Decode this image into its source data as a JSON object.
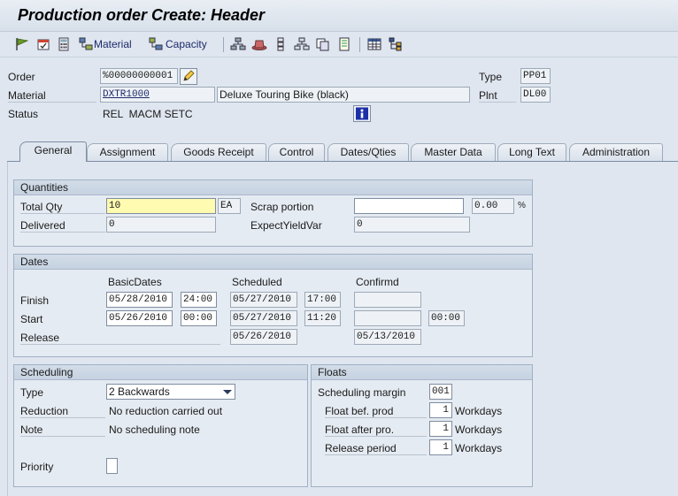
{
  "window": {
    "title": "Production order Create: Header"
  },
  "toolbar": {
    "material_label": "Material",
    "capacity_label": "Capacity"
  },
  "header": {
    "order_label": "Order",
    "order_value": "%00000000001",
    "type_label": "Type",
    "type_value": "PP01",
    "material_label": "Material",
    "material_value": "DXTR1000",
    "material_desc": "Deluxe Touring Bike (black)",
    "plnt_label": "Plnt",
    "plnt_value": "DL00",
    "status_label": "Status",
    "status_value": "REL  MACM SETC"
  },
  "tabs": [
    "General",
    "Assignment",
    "Goods Receipt",
    "Control",
    "Dates/Qties",
    "Master Data",
    "Long Text",
    "Administration"
  ],
  "quantities": {
    "title": "Quantities",
    "total_qty_label": "Total Qty",
    "total_qty_value": "10",
    "unit": "EA",
    "scrap_label": "Scrap portion",
    "scrap_value": "",
    "scrap_pct": "0.00",
    "pct_sign": "%",
    "delivered_label": "Delivered",
    "delivered_value": "0",
    "expect_label": "ExpectYieldVar",
    "expect_value": "0"
  },
  "dates": {
    "title": "Dates",
    "col_basic": "BasicDates",
    "col_scheduled": "Scheduled",
    "col_confirmed": "Confirmd",
    "finish_label": "Finish",
    "finish_basic_date": "05/28/2010",
    "finish_basic_time": "24:00",
    "finish_sched_date": "05/27/2010",
    "finish_sched_time": "17:00",
    "start_label": "Start",
    "start_basic_date": "05/26/2010",
    "start_basic_time": "00:00",
    "start_sched_date": "05/27/2010",
    "start_sched_time": "11:20",
    "start_conf_time": "00:00",
    "release_label": "Release",
    "release_sched_date": "05/26/2010",
    "release_conf_date": "05/13/2010"
  },
  "scheduling": {
    "title": "Scheduling",
    "type_label": "Type",
    "type_value": "2 Backwards",
    "reduction_label": "Reduction",
    "reduction_value": "No reduction carried out",
    "note_label": "Note",
    "note_value": "No scheduling note",
    "priority_label": "Priority",
    "priority_value": ""
  },
  "floats": {
    "title": "Floats",
    "margin_label": "Scheduling margin",
    "margin_value": "001",
    "before_label": "Float bef. prod",
    "before_value": "1",
    "after_label": "Float after pro.",
    "after_value": "1",
    "release_label": "Release period",
    "release_value": "1",
    "unit": "Workdays"
  },
  "colors": {
    "accent": "#1d2a6b",
    "focus_field": "#fffbb0",
    "info_button": "#1c2fa8"
  }
}
